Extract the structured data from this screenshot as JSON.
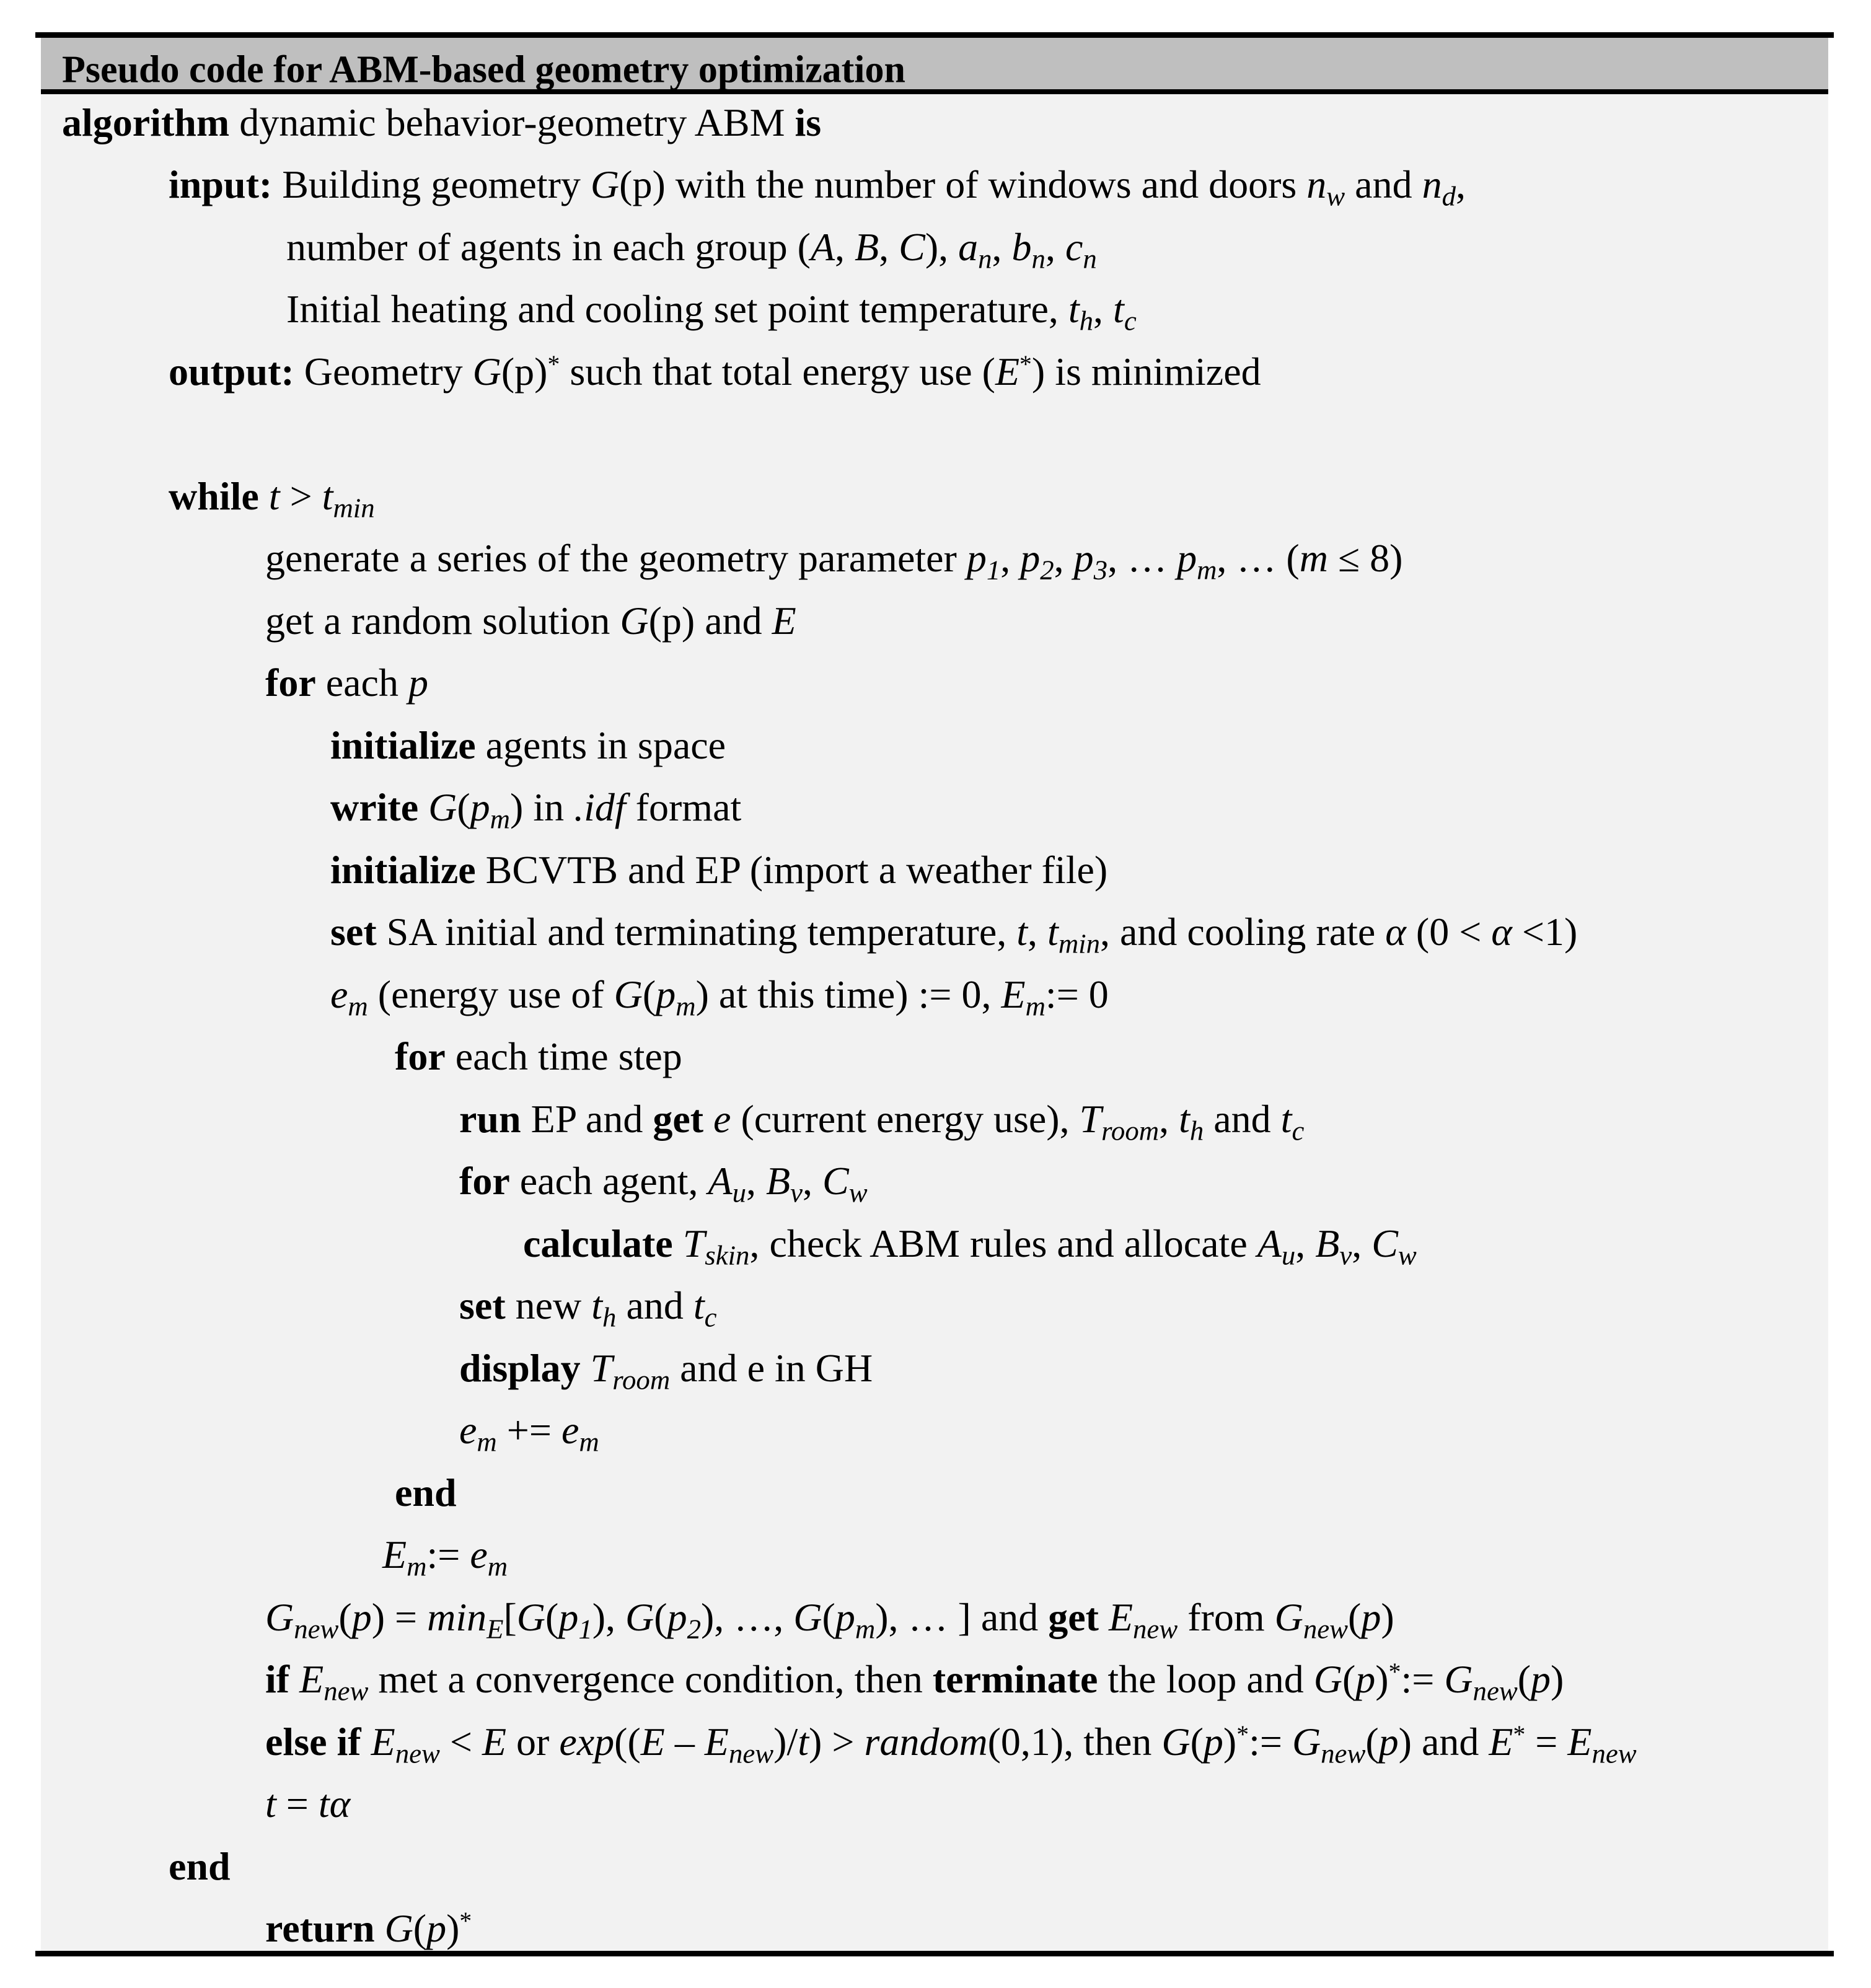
{
  "title": "Pseudo code for ABM-based geometry optimization",
  "colors": {
    "header_background": "#BFBFBF",
    "body_background": "#F2F2F2",
    "rule_color": "#000000"
  },
  "lines": [
    {
      "level": "L0",
      "segments": [
        {
          "t": "algorithm",
          "s": "b"
        },
        {
          "t": " dynamic behavior-geometry ABM "
        },
        {
          "t": "is",
          "s": "b"
        }
      ]
    },
    {
      "level": "L1",
      "segments": [
        {
          "t": "input:",
          "s": "b"
        },
        {
          "t": " Building geometry "
        },
        {
          "t": "G",
          "s": "i"
        },
        {
          "t": "(p) with the number of windows and doors "
        },
        {
          "t": "n",
          "s": "i"
        },
        {
          "t": "w",
          "s": "i",
          "sub": true
        },
        {
          "t": " and "
        },
        {
          "t": "n",
          "s": "i"
        },
        {
          "t": "d",
          "s": "i",
          "sub": true
        },
        {
          "t": ","
        }
      ]
    },
    {
      "level": "CONT",
      "segments": [
        {
          "t": "number of agents in each group ("
        },
        {
          "t": "A",
          "s": "i"
        },
        {
          "t": ", "
        },
        {
          "t": "B",
          "s": "i"
        },
        {
          "t": ", "
        },
        {
          "t": "C",
          "s": "i"
        },
        {
          "t": "), "
        },
        {
          "t": "a",
          "s": "i"
        },
        {
          "t": "n",
          "s": "i",
          "sub": true
        },
        {
          "t": ", "
        },
        {
          "t": "b",
          "s": "i"
        },
        {
          "t": "n",
          "s": "i",
          "sub": true
        },
        {
          "t": ", "
        },
        {
          "t": "c",
          "s": "i"
        },
        {
          "t": "n",
          "s": "i",
          "sub": true
        }
      ]
    },
    {
      "level": "CONT",
      "segments": [
        {
          "t": "Initial heating and cooling set point temperature, "
        },
        {
          "t": "t",
          "s": "i"
        },
        {
          "t": "h",
          "s": "i",
          "sub": true
        },
        {
          "t": ", "
        },
        {
          "t": "t",
          "s": "i"
        },
        {
          "t": "c",
          "s": "i",
          "sub": true
        }
      ]
    },
    {
      "level": "L1",
      "segments": [
        {
          "t": "output:",
          "s": "b"
        },
        {
          "t": " Geometry "
        },
        {
          "t": "G",
          "s": "i"
        },
        {
          "t": "(p)"
        },
        {
          "t": "*",
          "sup": true
        },
        {
          "t": " such that total energy use ("
        },
        {
          "t": "E",
          "s": "i"
        },
        {
          "t": "*",
          "sup": true
        },
        {
          "t": ") is minimized"
        }
      ]
    },
    {
      "level": "BLANK",
      "segments": []
    },
    {
      "level": "L1",
      "segments": [
        {
          "t": "while",
          "s": "b"
        },
        {
          "t": " "
        },
        {
          "t": "t",
          "s": "i"
        },
        {
          "t": " > "
        },
        {
          "t": "t",
          "s": "i"
        },
        {
          "t": "min",
          "s": "i",
          "sub": true
        }
      ]
    },
    {
      "level": "L2",
      "segments": [
        {
          "t": "generate a series of the geometry parameter "
        },
        {
          "t": "p",
          "s": "i"
        },
        {
          "t": "1",
          "s": "i",
          "sub": true
        },
        {
          "t": ", "
        },
        {
          "t": "p",
          "s": "i"
        },
        {
          "t": "2",
          "s": "i",
          "sub": true
        },
        {
          "t": ", "
        },
        {
          "t": "p",
          "s": "i"
        },
        {
          "t": "3",
          "s": "i",
          "sub": true
        },
        {
          "t": ", … "
        },
        {
          "t": "p",
          "s": "i"
        },
        {
          "t": "m",
          "s": "i",
          "sub": true
        },
        {
          "t": ", … ("
        },
        {
          "t": "m",
          "s": "i"
        },
        {
          "t": " ≤ 8)"
        }
      ]
    },
    {
      "level": "L2",
      "segments": [
        {
          "t": "get a random solution "
        },
        {
          "t": "G",
          "s": "i"
        },
        {
          "t": "(p) and "
        },
        {
          "t": "E",
          "s": "i"
        }
      ]
    },
    {
      "level": "L2",
      "segments": [
        {
          "t": "for",
          "s": "b"
        },
        {
          "t": " each "
        },
        {
          "t": "p",
          "s": "i"
        }
      ]
    },
    {
      "level": "L3",
      "segments": [
        {
          "t": "initialize",
          "s": "b"
        },
        {
          "t": " agents in space"
        }
      ]
    },
    {
      "level": "L3",
      "segments": [
        {
          "t": "write",
          "s": "b"
        },
        {
          "t": " "
        },
        {
          "t": "G",
          "s": "i"
        },
        {
          "t": "("
        },
        {
          "t": "p",
          "s": "i"
        },
        {
          "t": "m",
          "s": "i",
          "sub": true
        },
        {
          "t": ") in "
        },
        {
          "t": ".idf",
          "s": "i"
        },
        {
          "t": " format"
        }
      ]
    },
    {
      "level": "L3",
      "segments": [
        {
          "t": "initialize",
          "s": "b"
        },
        {
          "t": " BCVTB and EP (import a weather file)"
        }
      ]
    },
    {
      "level": "L3",
      "segments": [
        {
          "t": "set",
          "s": "b"
        },
        {
          "t": " SA initial and terminating temperature, "
        },
        {
          "t": "t",
          "s": "i"
        },
        {
          "t": ", "
        },
        {
          "t": "t",
          "s": "i"
        },
        {
          "t": "min",
          "s": "i",
          "sub": true
        },
        {
          "t": ", and cooling rate "
        },
        {
          "t": "α",
          "s": "i"
        },
        {
          "t": " (0 < "
        },
        {
          "t": "α",
          "s": "i"
        },
        {
          "t": " <1)"
        }
      ]
    },
    {
      "level": "L3",
      "segments": [
        {
          "t": "e",
          "s": "i"
        },
        {
          "t": "m",
          "s": "i",
          "sub": true
        },
        {
          "t": " (energy use of "
        },
        {
          "t": "G",
          "s": "i"
        },
        {
          "t": "("
        },
        {
          "t": "p",
          "s": "i"
        },
        {
          "t": "m",
          "s": "i",
          "sub": true
        },
        {
          "t": ") at this time) := 0, "
        },
        {
          "t": "E",
          "s": "i"
        },
        {
          "t": "m",
          "s": "i",
          "sub": true
        },
        {
          "t": ":= 0"
        }
      ]
    },
    {
      "level": "L4",
      "segments": [
        {
          "t": "for",
          "s": "b"
        },
        {
          "t": " each time step"
        }
      ]
    },
    {
      "level": "L5",
      "segments": [
        {
          "t": "run",
          "s": "b"
        },
        {
          "t": " EP and "
        },
        {
          "t": "get",
          "s": "b"
        },
        {
          "t": " "
        },
        {
          "t": "e",
          "s": "i"
        },
        {
          "t": " (current energy use), "
        },
        {
          "t": "T",
          "s": "i"
        },
        {
          "t": "room",
          "s": "i",
          "sub": true
        },
        {
          "t": ", "
        },
        {
          "t": "t",
          "s": "i"
        },
        {
          "t": "h",
          "s": "i",
          "sub": true
        },
        {
          "t": " and "
        },
        {
          "t": "t",
          "s": "i"
        },
        {
          "t": "c",
          "s": "i",
          "sub": true
        }
      ]
    },
    {
      "level": "L5",
      "segments": [
        {
          "t": "for",
          "s": "b"
        },
        {
          "t": " each agent, "
        },
        {
          "t": "A",
          "s": "i"
        },
        {
          "t": "u",
          "s": "i",
          "sub": true
        },
        {
          "t": ", "
        },
        {
          "t": "B",
          "s": "i"
        },
        {
          "t": "v",
          "s": "i",
          "sub": true
        },
        {
          "t": ", "
        },
        {
          "t": "C",
          "s": "i"
        },
        {
          "t": "w",
          "s": "i",
          "sub": true
        }
      ]
    },
    {
      "level": "L6",
      "segments": [
        {
          "t": "calculate",
          "s": "b"
        },
        {
          "t": " "
        },
        {
          "t": "T",
          "s": "i"
        },
        {
          "t": "skin",
          "s": "i",
          "sub": true
        },
        {
          "t": ", check ABM rules and allocate "
        },
        {
          "t": "A",
          "s": "i"
        },
        {
          "t": "u",
          "s": "i",
          "sub": true
        },
        {
          "t": ", "
        },
        {
          "t": "B",
          "s": "i"
        },
        {
          "t": "v",
          "s": "i",
          "sub": true
        },
        {
          "t": ", "
        },
        {
          "t": "C",
          "s": "i"
        },
        {
          "t": "w",
          "s": "i",
          "sub": true
        }
      ]
    },
    {
      "level": "L5",
      "segments": [
        {
          "t": "set",
          "s": "b"
        },
        {
          "t": " new "
        },
        {
          "t": "t",
          "s": "i"
        },
        {
          "t": "h",
          "s": "i",
          "sub": true
        },
        {
          "t": " and "
        },
        {
          "t": "t",
          "s": "i"
        },
        {
          "t": "c",
          "s": "i",
          "sub": true
        }
      ]
    },
    {
      "level": "L5",
      "segments": [
        {
          "t": "display",
          "s": "b"
        },
        {
          "t": " "
        },
        {
          "t": "T",
          "s": "i"
        },
        {
          "t": "room",
          "s": "i",
          "sub": true
        },
        {
          "t": " and e in GH"
        }
      ]
    },
    {
      "level": "L5",
      "segments": [
        {
          "t": "e",
          "s": "i"
        },
        {
          "t": "m",
          "s": "i",
          "sub": true
        },
        {
          "t": " += "
        },
        {
          "t": "e",
          "s": "i"
        },
        {
          "t": "m",
          "s": "i",
          "sub": true
        }
      ]
    },
    {
      "level": "L4",
      "segments": [
        {
          "t": "end",
          "s": "b"
        }
      ]
    },
    {
      "level": "LEM",
      "segments": [
        {
          "t": "E",
          "s": "i"
        },
        {
          "t": "m",
          "s": "i",
          "sub": true
        },
        {
          "t": ":= "
        },
        {
          "t": "e",
          "s": "i"
        },
        {
          "t": "m",
          "s": "i",
          "sub": true
        }
      ]
    },
    {
      "level": "L2",
      "segments": [
        {
          "t": "G",
          "s": "i"
        },
        {
          "t": "new",
          "s": "i",
          "sub": true
        },
        {
          "t": "("
        },
        {
          "t": "p",
          "s": "i"
        },
        {
          "t": ") = "
        },
        {
          "t": "min",
          "s": "i"
        },
        {
          "t": "E",
          "s": "i",
          "sub": true
        },
        {
          "t": "["
        },
        {
          "t": "G",
          "s": "i"
        },
        {
          "t": "("
        },
        {
          "t": "p",
          "s": "i"
        },
        {
          "t": "1",
          "s": "i",
          "sub": true
        },
        {
          "t": "), "
        },
        {
          "t": "G",
          "s": "i"
        },
        {
          "t": "("
        },
        {
          "t": "p",
          "s": "i"
        },
        {
          "t": "2",
          "s": "i",
          "sub": true
        },
        {
          "t": "), …, "
        },
        {
          "t": "G",
          "s": "i"
        },
        {
          "t": "("
        },
        {
          "t": "p",
          "s": "i"
        },
        {
          "t": "m",
          "s": "i",
          "sub": true
        },
        {
          "t": "), … ] and "
        },
        {
          "t": "get",
          "s": "b"
        },
        {
          "t": " "
        },
        {
          "t": "E",
          "s": "i"
        },
        {
          "t": "new",
          "s": "i",
          "sub": true
        },
        {
          "t": " from "
        },
        {
          "t": "G",
          "s": "i"
        },
        {
          "t": "new",
          "s": "i",
          "sub": true
        },
        {
          "t": "("
        },
        {
          "t": "p",
          "s": "i"
        },
        {
          "t": ")"
        }
      ]
    },
    {
      "level": "L2",
      "segments": [
        {
          "t": "if",
          "s": "b"
        },
        {
          "t": " "
        },
        {
          "t": "E",
          "s": "i"
        },
        {
          "t": "new",
          "s": "i",
          "sub": true
        },
        {
          "t": "  met a convergence condition, then "
        },
        {
          "t": "terminate",
          "s": "b"
        },
        {
          "t": " the loop and "
        },
        {
          "t": "G",
          "s": "i"
        },
        {
          "t": "("
        },
        {
          "t": "p",
          "s": "i"
        },
        {
          "t": ")"
        },
        {
          "t": "*",
          "sup": true
        },
        {
          "t": ":= "
        },
        {
          "t": "G",
          "s": "i"
        },
        {
          "t": "new",
          "s": "i",
          "sub": true
        },
        {
          "t": "("
        },
        {
          "t": "p",
          "s": "i"
        },
        {
          "t": ")"
        }
      ]
    },
    {
      "level": "L2",
      "segments": [
        {
          "t": "else if",
          "s": "b"
        },
        {
          "t": " "
        },
        {
          "t": "E",
          "s": "i"
        },
        {
          "t": "new",
          "s": "i",
          "sub": true
        },
        {
          "t": " < "
        },
        {
          "t": "E",
          "s": "i"
        },
        {
          "t": " or "
        },
        {
          "t": "exp",
          "s": "i"
        },
        {
          "t": "(("
        },
        {
          "t": "E",
          "s": "i"
        },
        {
          "t": " – "
        },
        {
          "t": "E",
          "s": "i"
        },
        {
          "t": "new",
          "s": "i",
          "sub": true
        },
        {
          "t": ")/"
        },
        {
          "t": "t",
          "s": "i"
        },
        {
          "t": ") > "
        },
        {
          "t": "random",
          "s": "i"
        },
        {
          "t": "(0,1), then "
        },
        {
          "t": "G",
          "s": "i"
        },
        {
          "t": "("
        },
        {
          "t": "p",
          "s": "i"
        },
        {
          "t": ")"
        },
        {
          "t": "*",
          "sup": true
        },
        {
          "t": ":= "
        },
        {
          "t": "G",
          "s": "i"
        },
        {
          "t": "new",
          "s": "i",
          "sub": true
        },
        {
          "t": "("
        },
        {
          "t": "p",
          "s": "i"
        },
        {
          "t": ") and "
        },
        {
          "t": "E",
          "s": "i"
        },
        {
          "t": "*",
          "sup": true
        },
        {
          "t": " = "
        },
        {
          "t": "E",
          "s": "i"
        },
        {
          "t": "new",
          "s": "i",
          "sub": true
        }
      ]
    },
    {
      "level": "L2",
      "segments": [
        {
          "t": "t",
          "s": "i"
        },
        {
          "t": " = "
        },
        {
          "t": "tα",
          "s": "i"
        }
      ]
    },
    {
      "level": "L1",
      "segments": [
        {
          "t": "end",
          "s": "b"
        }
      ]
    },
    {
      "level": "L2",
      "segments": [
        {
          "t": "return",
          "s": "b"
        },
        {
          "t": " "
        },
        {
          "t": "G",
          "s": "i"
        },
        {
          "t": "("
        },
        {
          "t": "p",
          "s": "i"
        },
        {
          "t": ")"
        },
        {
          "t": "*",
          "sup": true
        }
      ]
    }
  ]
}
